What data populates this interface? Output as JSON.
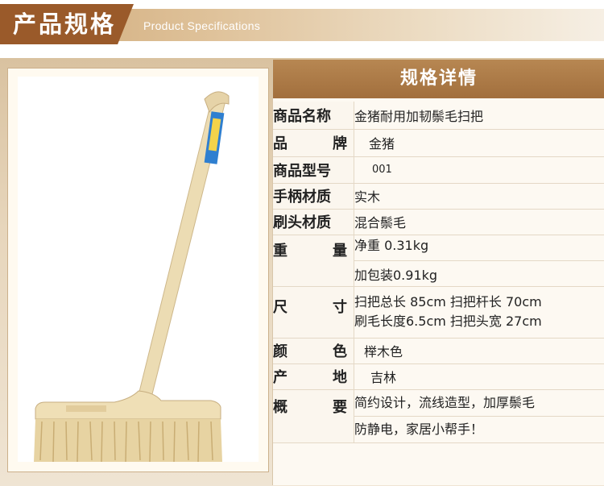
{
  "header": {
    "title_cn": "产品规格",
    "title_en": "Product Specifications"
  },
  "panel": {
    "title": "规格详情"
  },
  "specs": [
    {
      "label": "商品名称",
      "value": "金猪耐用加韧鬃毛扫把"
    },
    {
      "label_a": "品",
      "label_b": "牌",
      "value": "金猪"
    },
    {
      "label": "商品型号",
      "value": "001"
    },
    {
      "label": "手柄材质",
      "value": "实木"
    },
    {
      "label": "刷头材质",
      "value": "混合鬃毛"
    },
    {
      "label_a": "重",
      "label_b": "量",
      "value": "净重 0.31kg",
      "value2": "加包装0.91kg"
    },
    {
      "label_a": "尺",
      "label_b": "寸",
      "value": "扫把总长 85cm  扫把杆长 70cm",
      "value2": "刷毛长度6.5cm 扫把头宽 27cm"
    },
    {
      "label_a": "颜",
      "label_b": "色",
      "value": "榉木色"
    },
    {
      "label_a": "产",
      "label_b": "地",
      "value": "吉林"
    },
    {
      "label_a": "概",
      "label_b": "要",
      "value": "简约设计，流线造型，加厚鬃毛",
      "value2": "防静电，家居小帮手！"
    }
  ],
  "colors": {
    "header_badge": "#9a5a2a",
    "panel_head": "#a26f3d",
    "frame_bg": "#e7d6bc"
  }
}
